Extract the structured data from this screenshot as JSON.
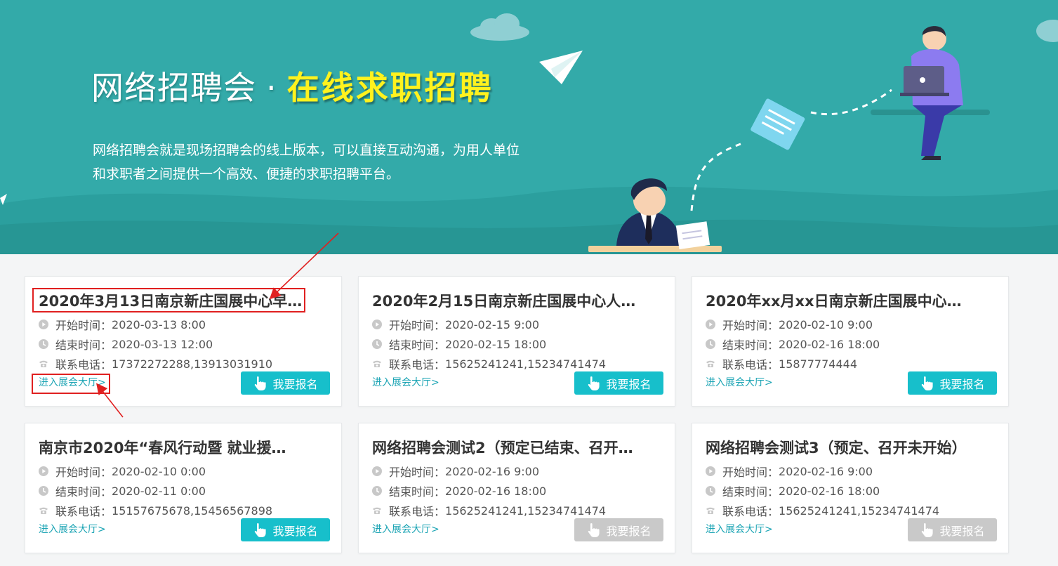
{
  "hero": {
    "title_main": "网络招聘会",
    "title_dot": "·",
    "title_highlight": "在线求职招聘",
    "description": "网络招聘会就是现场招聘会的线上版本，可以直接互动沟通，为用人单位和求职者之间提供一个高效、便捷的求职招聘平台。"
  },
  "labels": {
    "start": "开始时间：",
    "end": "结束时间：",
    "phone": "联系电话：",
    "enter_hall": "进入展会大厅>",
    "signup": "我要报名"
  },
  "icons": {
    "start": "play-circle-icon",
    "end": "clock-icon",
    "phone": "phone-icon",
    "signup": "hand-pointer-icon"
  },
  "colors": {
    "hero_bg": "#33aaa9",
    "accent": "#17bfcb",
    "highlight_text": "#fff21e",
    "disabled": "#c9c9c9",
    "annotation": "#e02020"
  },
  "fairs": [
    {
      "title": "2020年3月13日南京新庄国展中心早…",
      "start": "2020-03-13 8:00",
      "end": "2020-03-13 12:00",
      "phone": "17372272288,13913031910",
      "signup_enabled": true
    },
    {
      "title": "2020年2月15日南京新庄国展中心人…",
      "start": "2020-02-15 9:00",
      "end": "2020-02-15 18:00",
      "phone": "15625241241,15234741474",
      "signup_enabled": true
    },
    {
      "title": "2020年xx月xx日南京新庄国展中心…",
      "start": "2020-02-10 9:00",
      "end": "2020-02-16 18:00",
      "phone": "15877774444",
      "signup_enabled": true
    },
    {
      "title": "南京市2020年“春风行动暨 就业援…",
      "start": "2020-02-10 0:00",
      "end": "2020-02-11 0:00",
      "phone": "15157675678,15456567898",
      "signup_enabled": true
    },
    {
      "title": "网络招聘会测试2（预定已结束、召开…",
      "start": "2020-02-16 9:00",
      "end": "2020-02-16 18:00",
      "phone": "15625241241,15234741474",
      "signup_enabled": false
    },
    {
      "title": "网络招聘会测试3（预定、召开未开始）",
      "start": "2020-02-16 9:00",
      "end": "2020-02-16 18:00",
      "phone": "15625241241,15234741474",
      "signup_enabled": false
    }
  ]
}
